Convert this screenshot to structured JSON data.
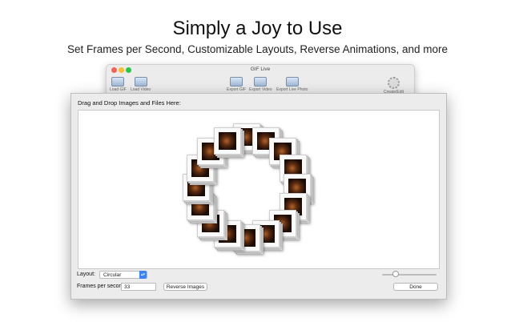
{
  "promo": {
    "headline": "Simply a Joy to Use",
    "subheadline": "Set Frames per Second, Customizable Layouts, Reverse Animations, and more"
  },
  "window": {
    "title": "GIF Live",
    "toolbar": {
      "load_gif": "Load GIF",
      "load_video": "Load Video",
      "export_gif": "Export GIF",
      "export_video": "Export Video",
      "export_live_photo": "Export Live Photo",
      "create_edit": "Create/Edit"
    }
  },
  "sheet": {
    "drop_label": "Drag and Drop Images and Files Here:",
    "layout_label": "Layout:",
    "layout_value": "Circular",
    "fps_label": "Frames per second:",
    "fps_value": "33",
    "reverse_button": "Reverse Images",
    "done_button": "Done",
    "size_slider_level": 0.25
  },
  "colors": {
    "accent": "#3b82f6",
    "close": "#fc5f57",
    "minimize": "#fdbc2e",
    "maximize": "#28c840"
  }
}
